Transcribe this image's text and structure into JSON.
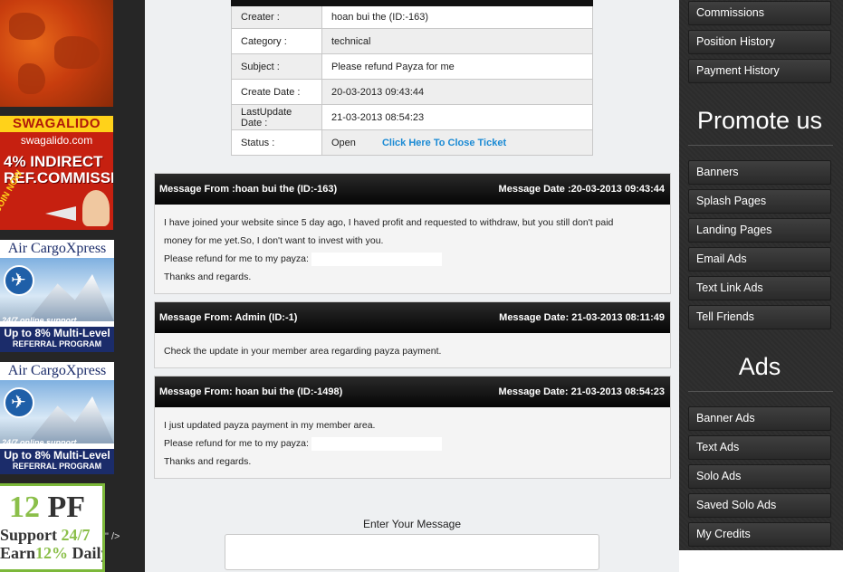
{
  "left_ads": {
    "swagalido": {
      "title": "SWAGALIDO",
      "url": "swagalido.com",
      "headline_1": "4% INDIRECT",
      "headline_2": "REF.COMMISSION",
      "cta": "JOIN NOW"
    },
    "cargo_1": {
      "title": "Air CargoXpress",
      "support": "24/7 online support",
      "line1": "Up to 8% Multi-Level",
      "line2": "REFERRAL PROGRAM"
    },
    "cargo_2": {
      "title": "Air CargoXpress",
      "support": "24/7 online support",
      "line1": "Up to 8% Multi-Level",
      "line2": "REFERRAL PROGRAM"
    },
    "pf": {
      "num": "12",
      "pf": "PF",
      "support_word": "Support",
      "support_hours": "24/7",
      "earn_word": "Earn",
      "earn_pct": "12%",
      "earn_daily": "Daily"
    },
    "stray_text": "\" />"
  },
  "ticket": {
    "rows": [
      {
        "label": "Creater :",
        "value": "hoan bui the (ID:-163)"
      },
      {
        "label": "Category :",
        "value": "technical"
      },
      {
        "label": "Subject :",
        "value": "Please refund Payza for me"
      },
      {
        "label": "Create Date :",
        "value": "20-03-2013 09:43:44"
      },
      {
        "label": "LastUpdate Date :",
        "value": "21-03-2013 08:54:23"
      },
      {
        "label": "Status :",
        "value": "Open"
      }
    ],
    "close_link": "Click Here To Close Ticket"
  },
  "messages": [
    {
      "from": "Message From :hoan bui the (ID:-163)",
      "date": "Message Date :20-03-2013 09:43:44",
      "line1": "I have joined your website since 5 day ago, I haved profit and requested to withdraw, but you still don't paid",
      "line2": "money for me yet.So, I don't want to invest with you.",
      "line3": "Please refund for me to my payza:",
      "line4": "Thanks and regards."
    },
    {
      "from": "Message From: Admin (ID:-1)",
      "date": "Message Date: 21-03-2013 08:11:49",
      "line1": "Check the update in your member area regarding payza payment."
    },
    {
      "from": "Message From: hoan bui the (ID:-1498)",
      "date": "Message Date: 21-03-2013 08:54:23",
      "line1": "I just updated payza payment in my member area.",
      "line2": "Please refund for me to my payza:",
      "line3": "Thanks and regards."
    }
  ],
  "reply": {
    "label": "Enter Your Message"
  },
  "sidebar": {
    "top_items": [
      "Commissions",
      "Position History",
      "Payment History"
    ],
    "promote_heading": "Promote us",
    "promote_items": [
      "Banners",
      "Splash Pages",
      "Landing Pages",
      "Email Ads",
      "Text Link Ads",
      "Tell Friends"
    ],
    "ads_heading": "Ads",
    "ads_items": [
      "Banner Ads",
      "Text Ads",
      "Solo Ads",
      "Saved Solo Ads",
      "My Credits"
    ]
  }
}
